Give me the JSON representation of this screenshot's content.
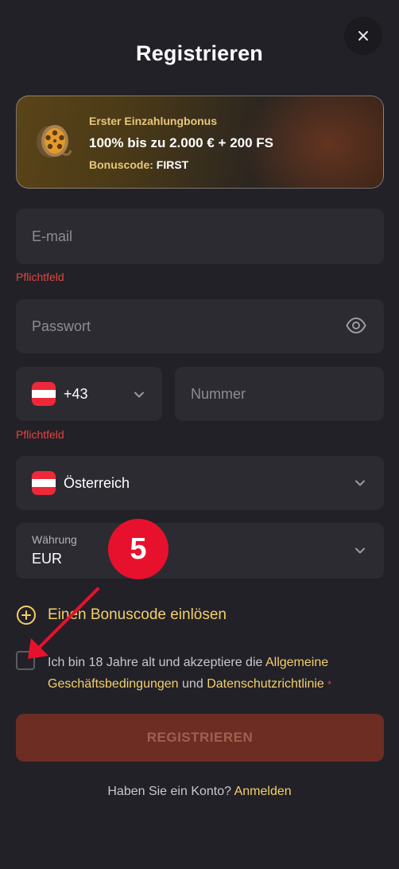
{
  "modal": {
    "title": "Registrieren",
    "close_icon": "close-icon"
  },
  "bonus": {
    "label": "Erster Einzahlungbonus",
    "offer": "100% bis zu 2.000 € + 200 FS",
    "code_label": "Bonuscode:",
    "code_value": "FIRST",
    "icon": "film-reel-icon"
  },
  "email": {
    "placeholder": "E-mail",
    "error": "Pflichtfeld"
  },
  "password": {
    "placeholder": "Passwort",
    "icon": "eye-icon"
  },
  "phone": {
    "country_code": "+43",
    "placeholder": "Nummer",
    "error": "Pflichtfeld",
    "flag": "austria-flag"
  },
  "country": {
    "value": "Österreich",
    "flag": "austria-flag"
  },
  "currency": {
    "label": "Währung",
    "value": "EUR"
  },
  "annotation": {
    "step_number": "5",
    "color": "#e8112d"
  },
  "bonus_code_link": "Einen Bonuscode einlösen",
  "terms": {
    "text_before": "Ich bin 18 Jahre alt und akzeptiere die",
    "link1": "Allgemeine Geschäftsbedingungen",
    "middle": "und",
    "link2": "Datenschutzrichtlinie",
    "required_marker": "*"
  },
  "register_button": "REGISTRIEREN",
  "login": {
    "prompt": "Haben Sie ein Konto?",
    "link": "Anmelden"
  },
  "colors": {
    "background": "#232128",
    "field": "#2d2b32",
    "accent_gold": "#f2cf6b",
    "error_red": "#e2453c",
    "button_disabled": "#6e2d22"
  }
}
